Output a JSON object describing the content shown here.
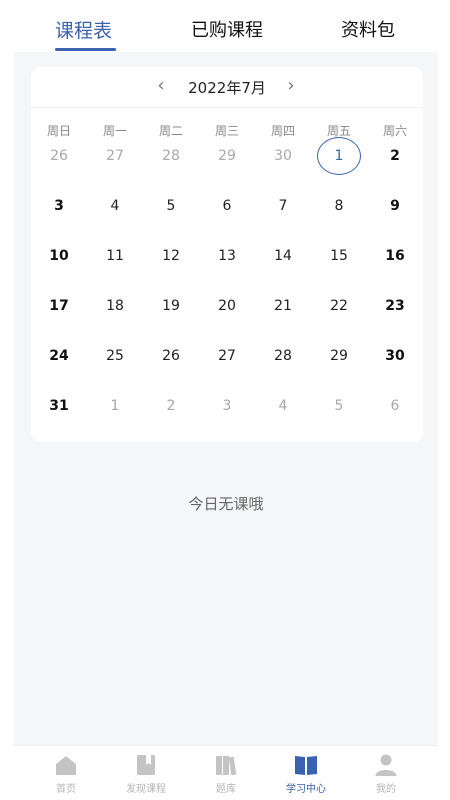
{
  "tabs": [
    {
      "label": "课程表",
      "active": true
    },
    {
      "label": "已购课程",
      "active": false
    },
    {
      "label": "资料包",
      "active": false
    }
  ],
  "calendar": {
    "prev_icon": "‹",
    "next_icon": "›",
    "month_label": "2022年7月",
    "weekdays": [
      "周日",
      "周一",
      "周二",
      "周三",
      "周四",
      "周五",
      "周六"
    ],
    "weeks": [
      [
        {
          "d": "26",
          "out": true
        },
        {
          "d": "27",
          "out": true
        },
        {
          "d": "28",
          "out": true
        },
        {
          "d": "29",
          "out": true
        },
        {
          "d": "30",
          "out": true
        },
        {
          "d": "1",
          "out": false,
          "today": true
        },
        {
          "d": "2",
          "out": false
        }
      ],
      [
        {
          "d": "3",
          "out": false
        },
        {
          "d": "4",
          "out": false
        },
        {
          "d": "5",
          "out": false
        },
        {
          "d": "6",
          "out": false
        },
        {
          "d": "7",
          "out": false
        },
        {
          "d": "8",
          "out": false
        },
        {
          "d": "9",
          "out": false
        }
      ],
      [
        {
          "d": "10",
          "out": false
        },
        {
          "d": "11",
          "out": false
        },
        {
          "d": "12",
          "out": false
        },
        {
          "d": "13",
          "out": false
        },
        {
          "d": "14",
          "out": false
        },
        {
          "d": "15",
          "out": false
        },
        {
          "d": "16",
          "out": false
        }
      ],
      [
        {
          "d": "17",
          "out": false
        },
        {
          "d": "18",
          "out": false
        },
        {
          "d": "19",
          "out": false
        },
        {
          "d": "20",
          "out": false
        },
        {
          "d": "21",
          "out": false
        },
        {
          "d": "22",
          "out": false
        },
        {
          "d": "23",
          "out": false
        }
      ],
      [
        {
          "d": "24",
          "out": false
        },
        {
          "d": "25",
          "out": false
        },
        {
          "d": "26",
          "out": false
        },
        {
          "d": "27",
          "out": false
        },
        {
          "d": "28",
          "out": false
        },
        {
          "d": "29",
          "out": false
        },
        {
          "d": "30",
          "out": false
        }
      ],
      [
        {
          "d": "31",
          "out": false
        },
        {
          "d": "1",
          "out": true
        },
        {
          "d": "2",
          "out": true
        },
        {
          "d": "3",
          "out": true
        },
        {
          "d": "4",
          "out": true
        },
        {
          "d": "5",
          "out": true
        },
        {
          "d": "6",
          "out": true
        }
      ]
    ]
  },
  "empty_message": "今日无课哦",
  "bottom_nav": [
    {
      "label": "首页",
      "icon": "home-icon",
      "active": false
    },
    {
      "label": "发现课程",
      "icon": "book-icon",
      "active": false
    },
    {
      "label": "题库",
      "icon": "question-bank-icon",
      "active": false
    },
    {
      "label": "学习中心",
      "icon": "open-book-icon",
      "active": true
    },
    {
      "label": "我的",
      "icon": "user-icon",
      "active": false
    }
  ],
  "colors": {
    "accent": "#3a62b0",
    "inactive": "#b5b5b5",
    "background": "#f5f6f7"
  }
}
